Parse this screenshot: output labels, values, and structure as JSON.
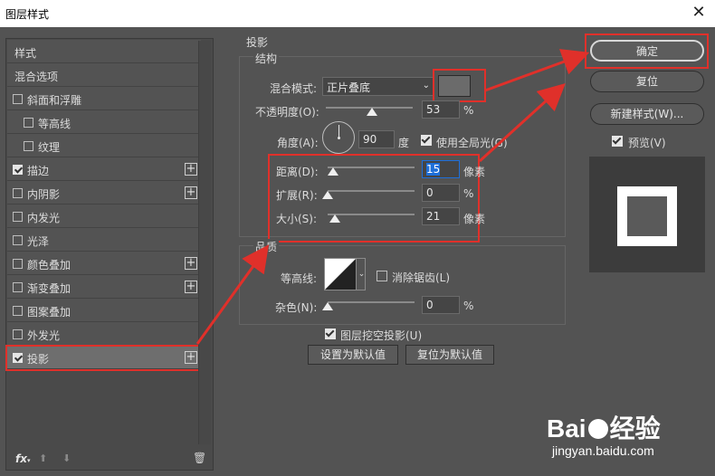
{
  "window": {
    "title": "图层样式",
    "close_glyph": "✕"
  },
  "left_panel": {
    "header": "样式",
    "blend_options": "混合选项",
    "items": [
      {
        "label": "斜面和浮雕",
        "checked": false,
        "plus": false,
        "indent": false
      },
      {
        "label": "等高线",
        "checked": false,
        "plus": false,
        "indent": true
      },
      {
        "label": "纹理",
        "checked": false,
        "plus": false,
        "indent": true
      },
      {
        "label": "描边",
        "checked": true,
        "plus": true,
        "indent": false
      },
      {
        "label": "内阴影",
        "checked": false,
        "plus": true,
        "indent": false
      },
      {
        "label": "内发光",
        "checked": false,
        "plus": false,
        "indent": false
      },
      {
        "label": "光泽",
        "checked": false,
        "plus": false,
        "indent": false
      },
      {
        "label": "颜色叠加",
        "checked": false,
        "plus": true,
        "indent": false
      },
      {
        "label": "渐变叠加",
        "checked": false,
        "plus": true,
        "indent": false
      },
      {
        "label": "图案叠加",
        "checked": false,
        "plus": false,
        "indent": false
      },
      {
        "label": "外发光",
        "checked": false,
        "plus": false,
        "indent": false
      },
      {
        "label": "投影",
        "checked": true,
        "plus": true,
        "indent": false,
        "selected": true
      }
    ],
    "plus_glyph": "+",
    "fx_label": "fx",
    "fx_dot": "▾",
    "up_glyph": "⬆",
    "down_glyph": "⬇",
    "trash_glyph": "🗑"
  },
  "shadow": {
    "section_title": "投影",
    "structure_title": "结构",
    "blend_mode_label": "混合模式:",
    "blend_mode_value": "正片叠底",
    "opacity_label": "不透明度(O):",
    "opacity_value": "53",
    "opacity_fraction": 0.53,
    "angle_label": "角度(A):",
    "angle_value": "90",
    "angle_unit": "度",
    "global_light_label": "使用全局光(G)",
    "distance_label": "距离(D):",
    "distance_value": "15",
    "distance_unit": "像素",
    "distance_fraction": 0.06,
    "spread_label": "扩展(R):",
    "spread_value": "0",
    "spread_fraction": 0,
    "size_label": "大小(S):",
    "size_value": "21",
    "size_unit": "像素",
    "size_fraction": 0.085,
    "percent": "%",
    "quality_title": "品质",
    "contour_label": "等高线:",
    "antialias_label": "消除锯齿(L)",
    "noise_label": "杂色(N):",
    "noise_value": "0",
    "noise_fraction": 0,
    "knockout_label": "图层挖空投影(U)",
    "set_default": "设置为默认值",
    "reset_default": "复位为默认值",
    "shadow_color": "#6b6b6b"
  },
  "buttons": {
    "ok": "确定",
    "reset": "复位",
    "new_style": "新建样式(W)...",
    "preview_label": "预览(V)"
  },
  "watermark": {
    "brand_left": "Bai",
    "brand_right": "经验",
    "url": "jingyan.baidu.com"
  },
  "colors": {
    "highlight": "#e0302a",
    "accent_field": "#1e6fd9"
  }
}
